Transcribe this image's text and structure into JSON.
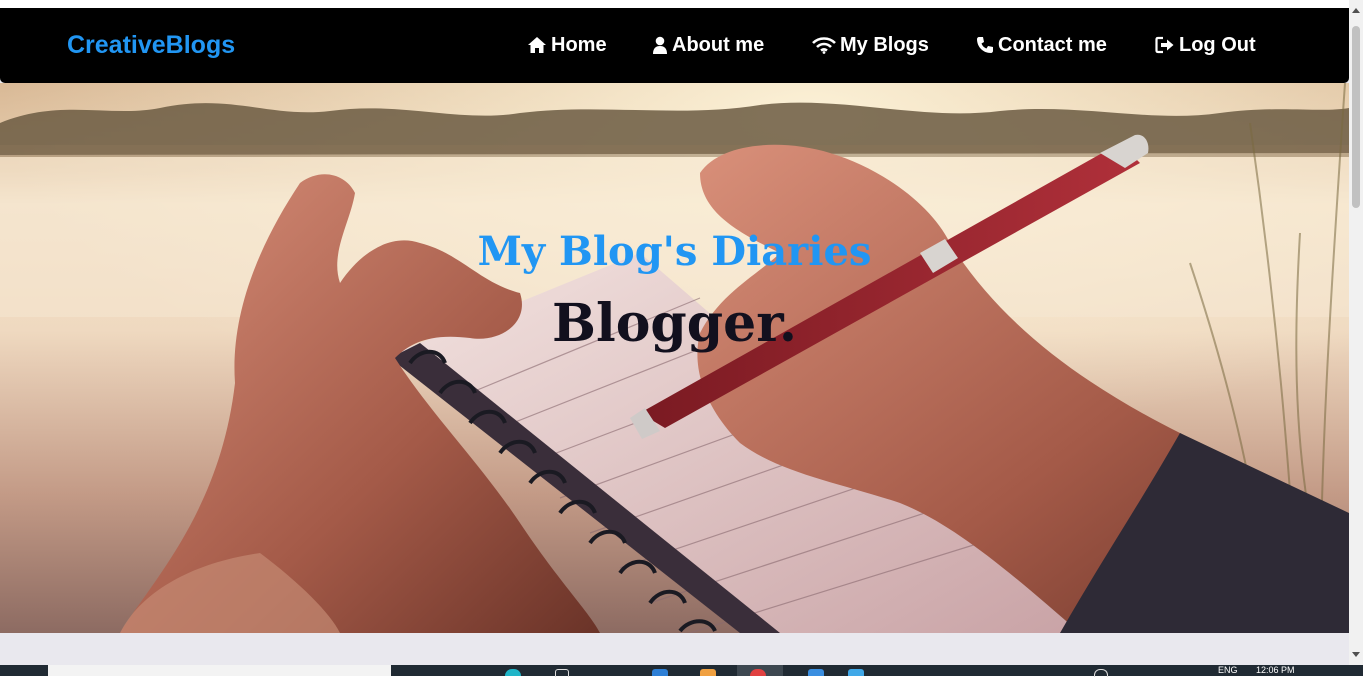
{
  "navbar": {
    "brand": "CreativeBlogs",
    "items": [
      {
        "label": "Home",
        "icon": "home-icon"
      },
      {
        "label": "About me",
        "icon": "user-icon"
      },
      {
        "label": "My Blogs",
        "icon": "wifi-icon"
      },
      {
        "label": "Contact me",
        "icon": "phone-icon"
      },
      {
        "label": "Log Out",
        "icon": "sign-out-icon"
      }
    ]
  },
  "hero": {
    "subtitle": "My Blog's Diaries",
    "title": "Blogger."
  },
  "taskbar": {
    "language": "ENG",
    "time": "12:06 PM"
  },
  "colors": {
    "accent": "#2196f3",
    "navbar_bg": "#000000",
    "title_color": "#12101e"
  }
}
